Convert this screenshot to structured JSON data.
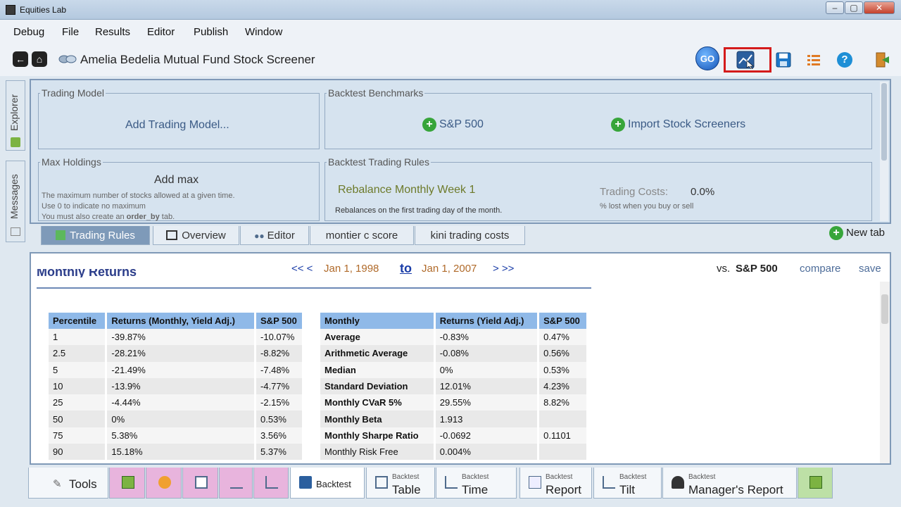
{
  "window": {
    "title": "Equities Lab",
    "minimize": "–",
    "maximize": "▢",
    "close": "✕"
  },
  "menu": [
    "Debug",
    "File",
    "Results",
    "Editor",
    "Publish",
    "Window"
  ],
  "toolbar": {
    "page_title": "Amelia Bedelia Mutual Fund Stock Screener",
    "go_label": "GO",
    "help_label": "?"
  },
  "side_tabs": {
    "explorer": "Explorer",
    "messages": "Messages"
  },
  "panels": {
    "trading_model": {
      "legend": "Trading Model",
      "action": "Add Trading Model..."
    },
    "backtest_benchmarks": {
      "legend": "Backtest Benchmarks",
      "sp500": "S&P 500",
      "import": "Import Stock Screeners"
    },
    "max_holdings": {
      "legend": "Max Holdings",
      "action": "Add max",
      "help1": "The maximum number of stocks allowed at a given time.",
      "help2": "Use 0 to indicate no maximum",
      "help3a": "You must also create an ",
      "help3b": "order_by",
      "help3c": " tab."
    },
    "trading_rules": {
      "legend": "Backtest Trading Rules",
      "rebalance": "Rebalance Monthly Week 1",
      "rebalance_note": "Rebalances on the first trading day of the month.",
      "costs_label": "Trading Costs:",
      "costs_value": "0.0%",
      "costs_note": "% lost when you buy or sell"
    }
  },
  "tabs": [
    "Trading Rules",
    "Overview",
    "Editor",
    "montier c score",
    "kini trading costs"
  ],
  "new_tab": "New tab",
  "datebar": {
    "back": "<< <",
    "start": "Jan 1, 1998",
    "to": "to",
    "end": "Jan 1, 2007",
    "fwd": "> >>",
    "vs": "vs.",
    "benchmark": "S&P 500",
    "compare": "compare",
    "save": "save"
  },
  "report": {
    "heading": "Monthly Returns",
    "percentile_table": {
      "headers": [
        "Percentile",
        "Returns (Monthly, Yield Adj.)",
        "S&P 500"
      ],
      "rows": [
        [
          "1",
          "-39.87%",
          "-10.07%"
        ],
        [
          "2.5",
          "-28.21%",
          "-8.82%"
        ],
        [
          "5",
          "-21.49%",
          "-7.48%"
        ],
        [
          "10",
          "-13.9%",
          "-4.77%"
        ],
        [
          "25",
          "-4.44%",
          "-2.15%"
        ],
        [
          "50",
          "0%",
          "0.53%"
        ],
        [
          "75",
          "5.38%",
          "3.56%"
        ],
        [
          "90",
          "15.18%",
          "5.37%"
        ]
      ]
    },
    "monthly_table": {
      "headers": [
        "Monthly",
        "Returns (Yield Adj.)",
        "S&P 500"
      ],
      "rows": [
        [
          "Average",
          "-0.83%",
          "0.47%"
        ],
        [
          "Arithmetic Average",
          "-0.08%",
          "0.56%"
        ],
        [
          "Median",
          "0%",
          "0.53%"
        ],
        [
          "Standard Deviation",
          "12.01%",
          "4.23%"
        ],
        [
          "Monthly CVaR 5%",
          "29.55%",
          "8.82%"
        ],
        [
          "Monthly Beta",
          "1.913",
          ""
        ],
        [
          "Monthly Sharpe Ratio",
          "-0.0692",
          "0.1101"
        ],
        [
          "Monthly Risk Free",
          "0.004%",
          ""
        ]
      ]
    }
  },
  "bottom_tabs": {
    "tools": "Tools",
    "backtest": "Backtest",
    "bt_small": "Backtest",
    "table": "Table",
    "time": "Time",
    "report": "Report",
    "tilt": "Tilt",
    "managers": "Manager's Report"
  }
}
